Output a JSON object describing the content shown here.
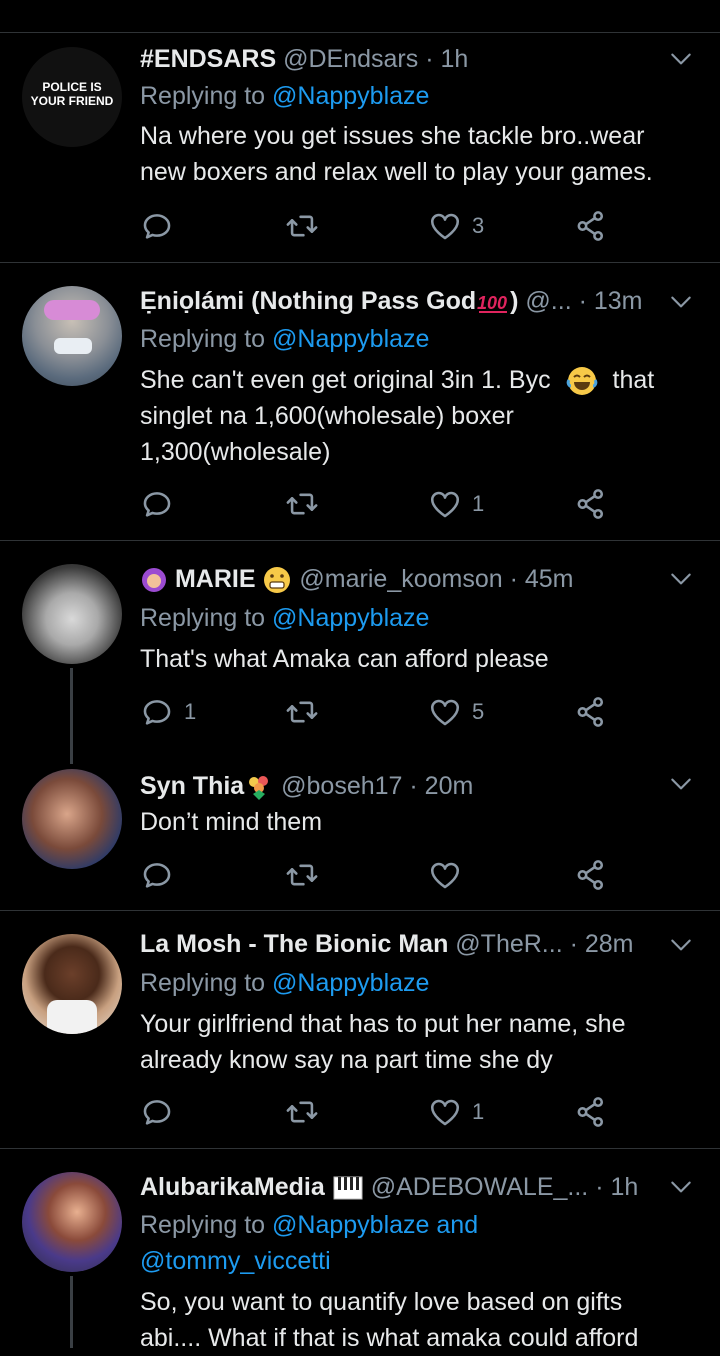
{
  "reply_prefix": "Replying to",
  "tweets": [
    {
      "name": "#ENDSARS",
      "handle_time": "@DEndsars · 1h",
      "avatar_text": [
        "POLICE IS",
        "YOUR FRIEND"
      ],
      "reply_to": "@Nappyblaze",
      "text": [
        "Na where you get issues she tackle bro..wear",
        "new boxers and relax well to play your games."
      ],
      "reply_count": "",
      "like_count": "3"
    },
    {
      "name": "Ẹniọlámi (Nothing Pass God",
      "name_end": ")",
      "handle_time": "@...  · 13m",
      "reply_to": "@Nappyblaze",
      "text_a": "She can't even get original 3in 1.  Byc",
      "text_b": "that",
      "text": [
        "singlet na 1,600(wholesale) boxer",
        "1,300(wholesale)"
      ],
      "reply_count": "",
      "like_count": "1"
    },
    {
      "name": "MARIE",
      "handle_time": "@marie_koomson · 45m",
      "reply_to": "@Nappyblaze",
      "text": [
        "That's what Amaka can afford please"
      ],
      "reply_count": "1",
      "like_count": "5"
    },
    {
      "name": "Syn Thia",
      "handle_time": "@boseh17 · 20m",
      "text": [
        "Don’t mind them"
      ],
      "reply_count": "",
      "like_count": ""
    },
    {
      "name": "La Mosh - The Bionic Man",
      "handle_time": "@TheR...  · 28m",
      "reply_to": "@Nappyblaze",
      "text": [
        "Your girlfriend that has to put her name, she",
        "already know say na part time she dy"
      ],
      "reply_count": "",
      "like_count": "1"
    },
    {
      "name": "AlubarikaMedia",
      "handle_time": "@ADEBOWALE_...  · 1h",
      "reply_to": "@Nappyblaze and",
      "reply_to_2": "@tommy_viccetti",
      "text": [
        "So, you want to quantify love based on gifts",
        "abi.... What if that is what amaka could afford"
      ]
    }
  ],
  "colors": {
    "background": "#000000",
    "text": "#e7e9ea",
    "muted": "#8b98a5",
    "link": "#1d9bf0",
    "separator": "#2f3336"
  },
  "icons": [
    "reply-icon",
    "retweet-icon",
    "like-icon",
    "share-icon",
    "chevron-down-icon"
  ]
}
